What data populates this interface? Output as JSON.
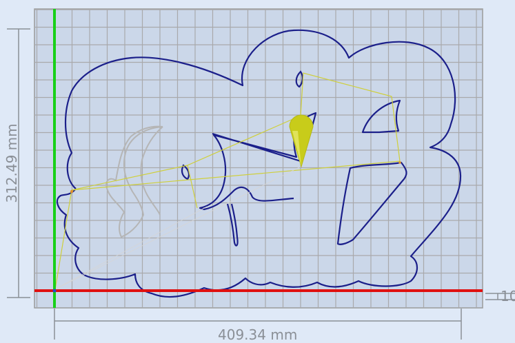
{
  "dimensions": {
    "width_label": "409.34 mm",
    "height_label": "312.49 mm",
    "depth_label": "10"
  },
  "colors": {
    "background": "#dfe9f7",
    "bed_fill": "#cbd7e9",
    "grid_line": "#a9a9ab",
    "x_axis": "#e01010",
    "y_axis": "#18d018",
    "path_outline": "#1b1f8a",
    "toolpath_line": "#cfcf3a",
    "tool_marker": "#c8cc1a",
    "ghost_outline": "#b8b8b8",
    "dimension_line": "#8a8f96"
  },
  "icons": {
    "tool_marker": "cone-tool-icon"
  }
}
